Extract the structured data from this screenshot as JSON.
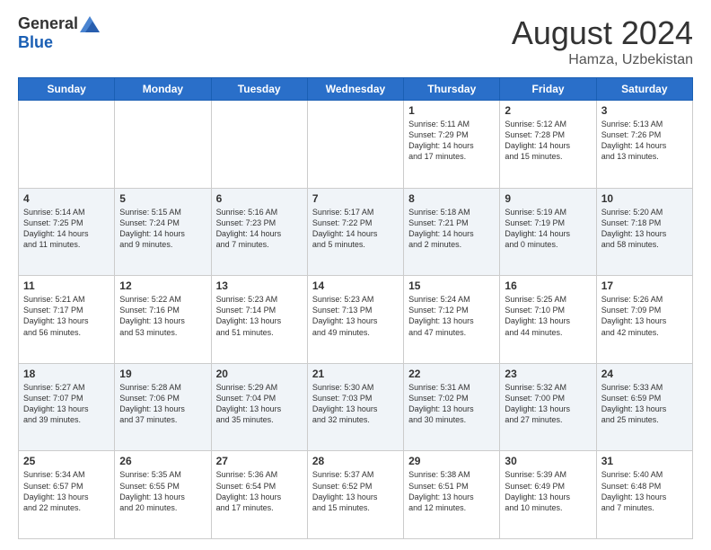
{
  "header": {
    "logo_general": "General",
    "logo_blue": "Blue",
    "month_year": "August 2024",
    "location": "Hamza, Uzbekistan"
  },
  "days_of_week": [
    "Sunday",
    "Monday",
    "Tuesday",
    "Wednesday",
    "Thursday",
    "Friday",
    "Saturday"
  ],
  "weeks": [
    [
      {
        "day": "",
        "info": ""
      },
      {
        "day": "",
        "info": ""
      },
      {
        "day": "",
        "info": ""
      },
      {
        "day": "",
        "info": ""
      },
      {
        "day": "1",
        "info": "Sunrise: 5:11 AM\nSunset: 7:29 PM\nDaylight: 14 hours\nand 17 minutes."
      },
      {
        "day": "2",
        "info": "Sunrise: 5:12 AM\nSunset: 7:28 PM\nDaylight: 14 hours\nand 15 minutes."
      },
      {
        "day": "3",
        "info": "Sunrise: 5:13 AM\nSunset: 7:26 PM\nDaylight: 14 hours\nand 13 minutes."
      }
    ],
    [
      {
        "day": "4",
        "info": "Sunrise: 5:14 AM\nSunset: 7:25 PM\nDaylight: 14 hours\nand 11 minutes."
      },
      {
        "day": "5",
        "info": "Sunrise: 5:15 AM\nSunset: 7:24 PM\nDaylight: 14 hours\nand 9 minutes."
      },
      {
        "day": "6",
        "info": "Sunrise: 5:16 AM\nSunset: 7:23 PM\nDaylight: 14 hours\nand 7 minutes."
      },
      {
        "day": "7",
        "info": "Sunrise: 5:17 AM\nSunset: 7:22 PM\nDaylight: 14 hours\nand 5 minutes."
      },
      {
        "day": "8",
        "info": "Sunrise: 5:18 AM\nSunset: 7:21 PM\nDaylight: 14 hours\nand 2 minutes."
      },
      {
        "day": "9",
        "info": "Sunrise: 5:19 AM\nSunset: 7:19 PM\nDaylight: 14 hours\nand 0 minutes."
      },
      {
        "day": "10",
        "info": "Sunrise: 5:20 AM\nSunset: 7:18 PM\nDaylight: 13 hours\nand 58 minutes."
      }
    ],
    [
      {
        "day": "11",
        "info": "Sunrise: 5:21 AM\nSunset: 7:17 PM\nDaylight: 13 hours\nand 56 minutes."
      },
      {
        "day": "12",
        "info": "Sunrise: 5:22 AM\nSunset: 7:16 PM\nDaylight: 13 hours\nand 53 minutes."
      },
      {
        "day": "13",
        "info": "Sunrise: 5:23 AM\nSunset: 7:14 PM\nDaylight: 13 hours\nand 51 minutes."
      },
      {
        "day": "14",
        "info": "Sunrise: 5:23 AM\nSunset: 7:13 PM\nDaylight: 13 hours\nand 49 minutes."
      },
      {
        "day": "15",
        "info": "Sunrise: 5:24 AM\nSunset: 7:12 PM\nDaylight: 13 hours\nand 47 minutes."
      },
      {
        "day": "16",
        "info": "Sunrise: 5:25 AM\nSunset: 7:10 PM\nDaylight: 13 hours\nand 44 minutes."
      },
      {
        "day": "17",
        "info": "Sunrise: 5:26 AM\nSunset: 7:09 PM\nDaylight: 13 hours\nand 42 minutes."
      }
    ],
    [
      {
        "day": "18",
        "info": "Sunrise: 5:27 AM\nSunset: 7:07 PM\nDaylight: 13 hours\nand 39 minutes."
      },
      {
        "day": "19",
        "info": "Sunrise: 5:28 AM\nSunset: 7:06 PM\nDaylight: 13 hours\nand 37 minutes."
      },
      {
        "day": "20",
        "info": "Sunrise: 5:29 AM\nSunset: 7:04 PM\nDaylight: 13 hours\nand 35 minutes."
      },
      {
        "day": "21",
        "info": "Sunrise: 5:30 AM\nSunset: 7:03 PM\nDaylight: 13 hours\nand 32 minutes."
      },
      {
        "day": "22",
        "info": "Sunrise: 5:31 AM\nSunset: 7:02 PM\nDaylight: 13 hours\nand 30 minutes."
      },
      {
        "day": "23",
        "info": "Sunrise: 5:32 AM\nSunset: 7:00 PM\nDaylight: 13 hours\nand 27 minutes."
      },
      {
        "day": "24",
        "info": "Sunrise: 5:33 AM\nSunset: 6:59 PM\nDaylight: 13 hours\nand 25 minutes."
      }
    ],
    [
      {
        "day": "25",
        "info": "Sunrise: 5:34 AM\nSunset: 6:57 PM\nDaylight: 13 hours\nand 22 minutes."
      },
      {
        "day": "26",
        "info": "Sunrise: 5:35 AM\nSunset: 6:55 PM\nDaylight: 13 hours\nand 20 minutes."
      },
      {
        "day": "27",
        "info": "Sunrise: 5:36 AM\nSunset: 6:54 PM\nDaylight: 13 hours\nand 17 minutes."
      },
      {
        "day": "28",
        "info": "Sunrise: 5:37 AM\nSunset: 6:52 PM\nDaylight: 13 hours\nand 15 minutes."
      },
      {
        "day": "29",
        "info": "Sunrise: 5:38 AM\nSunset: 6:51 PM\nDaylight: 13 hours\nand 12 minutes."
      },
      {
        "day": "30",
        "info": "Sunrise: 5:39 AM\nSunset: 6:49 PM\nDaylight: 13 hours\nand 10 minutes."
      },
      {
        "day": "31",
        "info": "Sunrise: 5:40 AM\nSunset: 6:48 PM\nDaylight: 13 hours\nand 7 minutes."
      }
    ]
  ]
}
